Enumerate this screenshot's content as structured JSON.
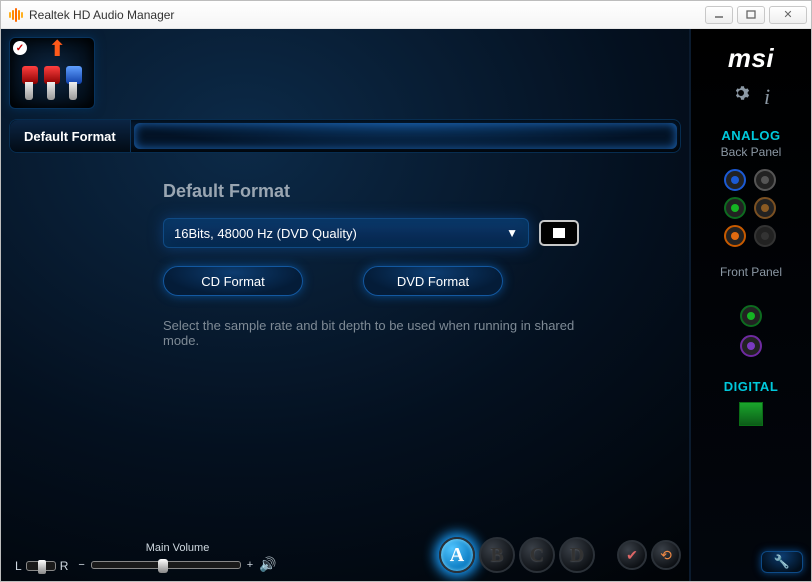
{
  "window": {
    "title": "Realtek HD Audio Manager"
  },
  "brand": "msi",
  "tab": {
    "active": "Default Format"
  },
  "section": {
    "title": "Default Format",
    "selected_format": "16Bits, 48000 Hz (DVD Quality)",
    "btn_cd": "CD Format",
    "btn_dvd": "DVD Format",
    "help": "Select the sample rate and bit depth to be used when running in shared mode."
  },
  "volume": {
    "lr_left": "L",
    "lr_right": "R",
    "minus": "−",
    "plus": "+",
    "label": "Main Volume"
  },
  "scenes": [
    "A",
    "B",
    "C",
    "D"
  ],
  "side": {
    "analog": "ANALOG",
    "back_panel": "Back Panel",
    "front_panel": "Front Panel",
    "digital": "DIGITAL"
  }
}
